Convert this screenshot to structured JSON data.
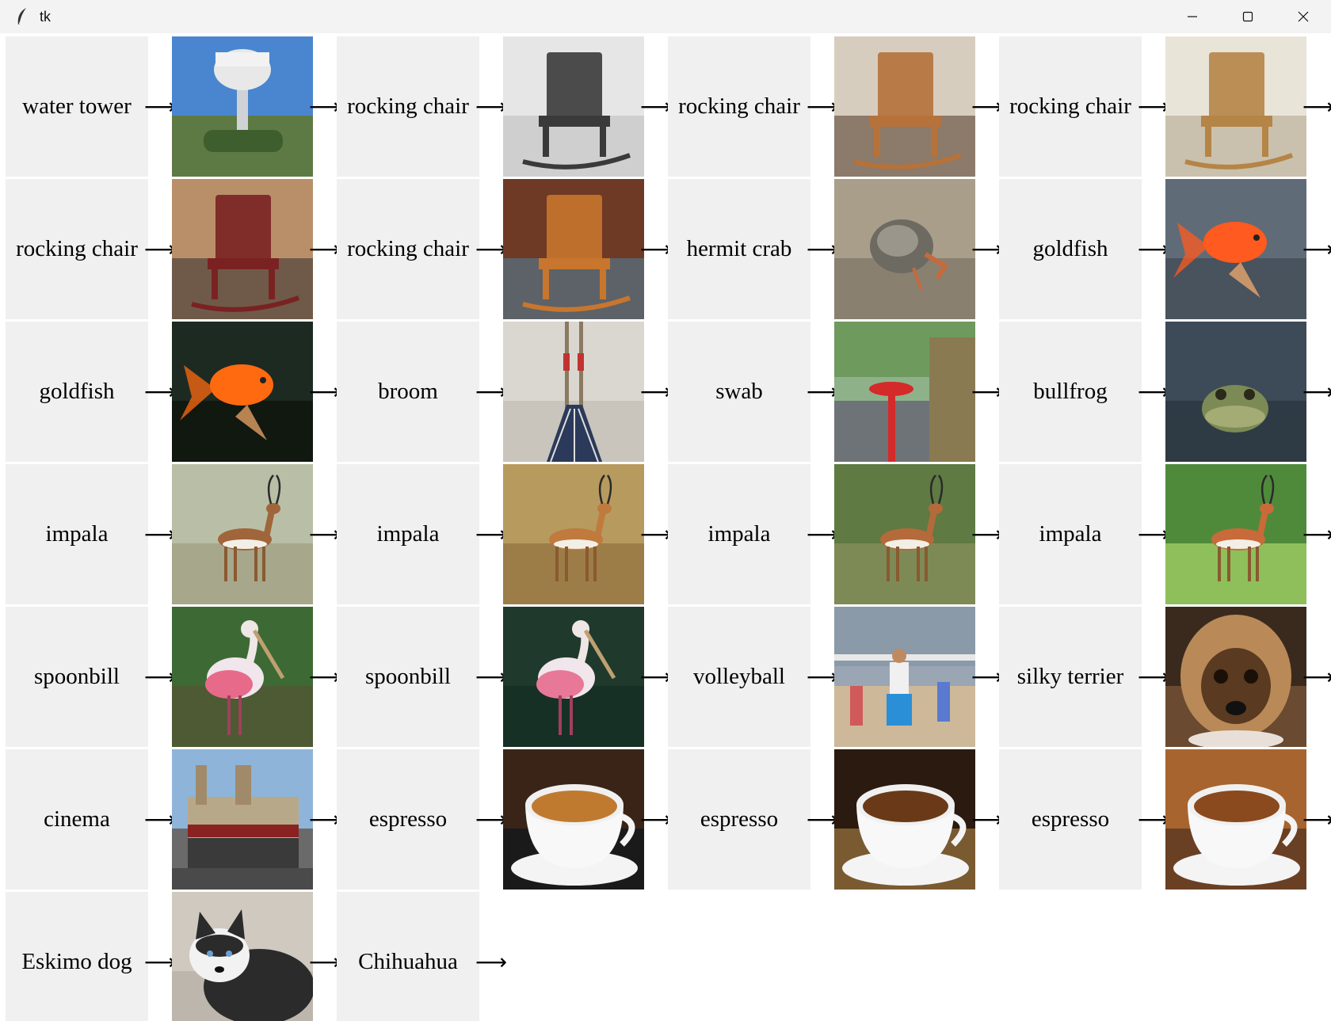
{
  "window": {
    "title": "tk"
  },
  "arrow": "⟶",
  "rows": [
    {
      "labels": [
        "water tower",
        "rocking chair",
        "rocking chair",
        "rocking chair"
      ],
      "images": [
        {
          "icon": "water-tower-photo",
          "sky": "#4a86cf",
          "ground": "#5e7a44",
          "accent": "#e8e8e8"
        },
        {
          "icon": "rocking-chair-photo",
          "sky": "#e6e6e6",
          "ground": "#cfcfcf",
          "accent": "#3a3a3a"
        },
        {
          "icon": "rocking-chair-photo",
          "sky": "#d7cdbf",
          "ground": "#8c7a6a",
          "accent": "#b5723a"
        },
        {
          "icon": "rocking-chair-photo",
          "sky": "#e8e4d8",
          "ground": "#c9c1ad",
          "accent": "#b58447"
        }
      ]
    },
    {
      "labels": [
        "rocking chair",
        "rocking chair",
        "hermit crab",
        "goldfish"
      ],
      "images": [
        {
          "icon": "rocking-chair-photo",
          "sky": "#b98f6a",
          "ground": "#6f5a49",
          "accent": "#7a2222"
        },
        {
          "icon": "rocking-chair-photo",
          "sky": "#6e3a25",
          "ground": "#5c6268",
          "accent": "#c8762e"
        },
        {
          "icon": "hermit-crab-photo",
          "sky": "#a89e8a",
          "ground": "#8a8070",
          "accent": "#c56a3c"
        },
        {
          "icon": "goldfish-photo",
          "sky": "#5f6c78",
          "ground": "#48535d",
          "accent": "#ff5a1f"
        }
      ]
    },
    {
      "labels": [
        "goldfish",
        "broom",
        "swab",
        "bullfrog"
      ],
      "images": [
        {
          "icon": "goldfish-photo",
          "sky": "#1d2a22",
          "ground": "#10180f",
          "accent": "#ff6a10"
        },
        {
          "icon": "broom-photo",
          "sky": "#dad7d0",
          "ground": "#c9c5bc",
          "accent": "#c23232"
        },
        {
          "icon": "swab-photo",
          "sky": "#8fb18a",
          "ground": "#6e7378",
          "accent": "#d42a2a"
        },
        {
          "icon": "bullfrog-photo",
          "sky": "#3d4a58",
          "ground": "#2e3a44",
          "accent": "#7c8a55"
        }
      ]
    },
    {
      "labels": [
        "impala",
        "impala",
        "impala",
        "impala"
      ],
      "images": [
        {
          "icon": "impala-photo",
          "sky": "#b9bfa6",
          "ground": "#a7a78c",
          "accent": "#a0653a"
        },
        {
          "icon": "impala-photo",
          "sky": "#b79a5e",
          "ground": "#9c7d47",
          "accent": "#c07a3e"
        },
        {
          "icon": "impala-photo",
          "sky": "#5f7a42",
          "ground": "#7e8a56",
          "accent": "#b46a3a"
        },
        {
          "icon": "impala-photo",
          "sky": "#4f8a3a",
          "ground": "#8fbf5a",
          "accent": "#c96a3a"
        }
      ]
    },
    {
      "labels": [
        "spoonbill",
        "spoonbill",
        "volleyball",
        "silky terrier"
      ],
      "images": [
        {
          "icon": "spoonbill-photo",
          "sky": "#3d6a34",
          "ground": "#4d5a34",
          "accent": "#e86a8a"
        },
        {
          "icon": "spoonbill-photo",
          "sky": "#1f3a2c",
          "ground": "#163026",
          "accent": "#e87898"
        },
        {
          "icon": "volleyball-photo",
          "sky": "#9aa6b4",
          "ground": "#cdb899",
          "accent": "#2a8fd6"
        },
        {
          "icon": "silky-terrier-photo",
          "sky": "#3a2a1e",
          "ground": "#6a4a30",
          "accent": "#b98a58"
        }
      ]
    },
    {
      "labels": [
        "cinema",
        "espresso",
        "espresso",
        "espresso"
      ],
      "images": [
        {
          "icon": "cinema-photo",
          "sky": "#8fb4d9",
          "ground": "#6a6a6a",
          "accent": "#b8a88a"
        },
        {
          "icon": "espresso-photo",
          "sky": "#3a2418",
          "ground": "#1a1a1a",
          "accent": "#c07a30"
        },
        {
          "icon": "espresso-photo",
          "sky": "#2a1a10",
          "ground": "#7a5a30",
          "accent": "#6a3a18"
        },
        {
          "icon": "espresso-photo",
          "sky": "#a8642e",
          "ground": "#6a4024",
          "accent": "#8a4a1e"
        }
      ]
    },
    {
      "labels": [
        "Eskimo dog",
        "Chihuahua"
      ],
      "images": [
        {
          "icon": "eskimo-dog-photo",
          "sky": "#cfc9c0",
          "ground": "#bdb6ac",
          "accent": "#2b2b2b"
        }
      ]
    }
  ]
}
